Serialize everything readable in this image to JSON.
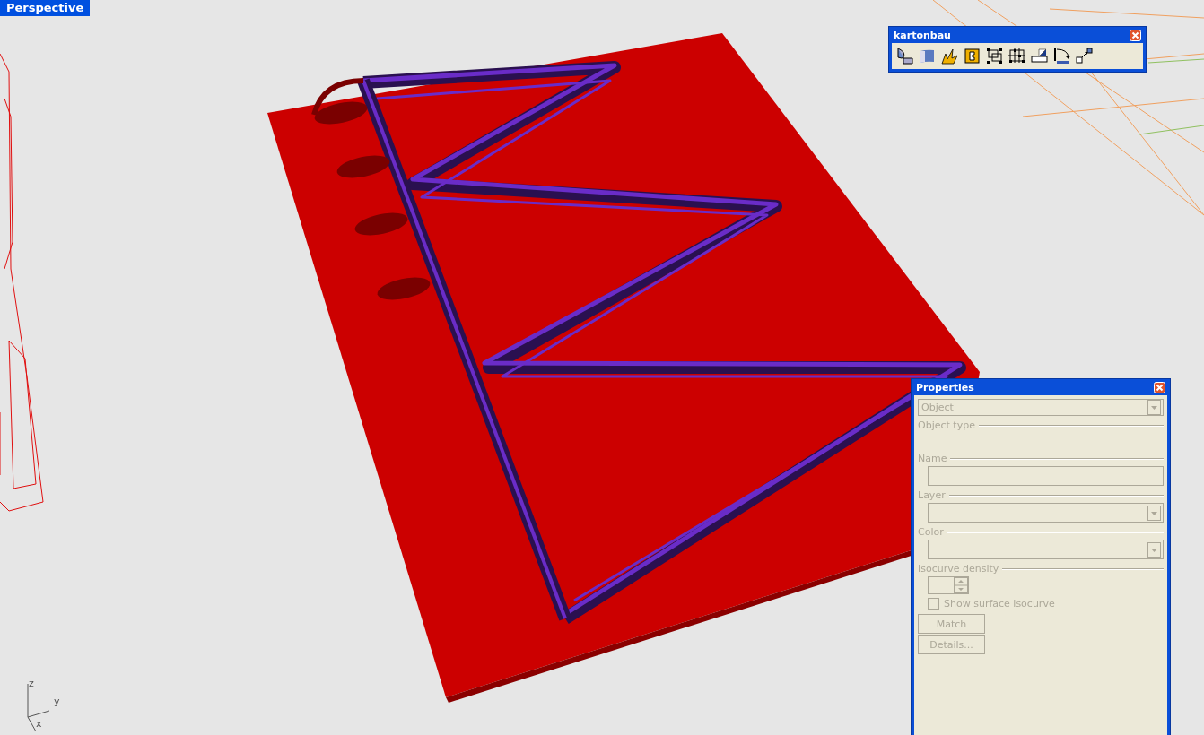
{
  "viewport": {
    "label": "Perspective",
    "axes": [
      "z",
      "y",
      "x"
    ]
  },
  "toolbar": {
    "title": "kartonbau"
  },
  "properties": {
    "title": "Properties",
    "disabled": true,
    "object_select": {
      "value": "Object"
    },
    "sections": [
      {
        "kind": "label",
        "title": "Object type"
      },
      {
        "kind": "text",
        "title": "Name"
      },
      {
        "kind": "select",
        "title": "Layer"
      },
      {
        "kind": "select",
        "title": "Color"
      },
      {
        "kind": "spinner",
        "title": "Isocurve density"
      }
    ],
    "checkbox": {
      "label": "Show surface isocurve",
      "checked": false
    },
    "buttons": [
      "Match",
      "Details..."
    ]
  }
}
